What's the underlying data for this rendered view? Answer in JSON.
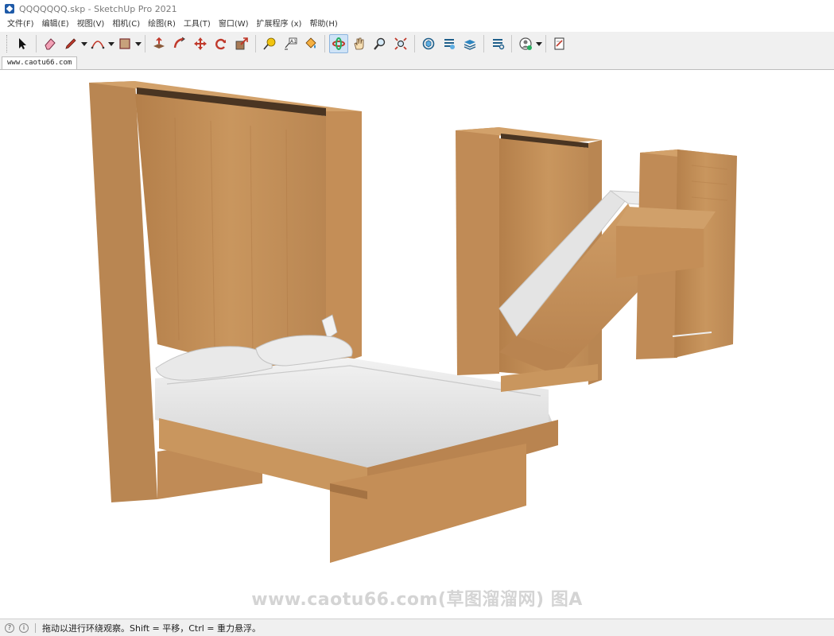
{
  "window": {
    "title": "QQQQQQQ.skp - SketchUp Pro 2021",
    "app_icon": "sketchup-logo-icon"
  },
  "menu": [
    {
      "label": "文件(F)"
    },
    {
      "label": "编辑(E)"
    },
    {
      "label": "视图(V)"
    },
    {
      "label": "相机(C)"
    },
    {
      "label": "绘图(R)"
    },
    {
      "label": "工具(T)"
    },
    {
      "label": "窗口(W)"
    },
    {
      "label": "扩展程序 (x)"
    },
    {
      "label": "帮助(H)"
    }
  ],
  "toolbar": {
    "tools": [
      "select-arrow-icon",
      "eraser-icon",
      "pencil-line-icon",
      "arc-icon",
      "rectangle-icon",
      "push-pull-icon",
      "follow-me-icon",
      "move-icon",
      "rotate-icon",
      "scale-icon",
      "tape-measure-icon",
      "text-label-icon",
      "paint-bucket-icon",
      "orbit-icon",
      "pan-hand-icon",
      "zoom-icon",
      "zoom-extents-icon",
      "3d-warehouse-icon",
      "extension-warehouse-icon",
      "layout-icon",
      "extension-manager-icon",
      "account-icon",
      "send-to-layout-icon"
    ],
    "active_tool": "orbit-icon"
  },
  "scene_tab": {
    "label": "www.caotu66.com"
  },
  "viewport": {
    "background": "#ffffff",
    "wood_color": "#c8955a",
    "sheet_color": "#e6e6e6",
    "watermark": "www.caotu66.com(草图溜溜网) 图A"
  },
  "status": {
    "icons": [
      "geo-location-icon",
      "info-icon"
    ],
    "text": "拖动以进行环绕观察。Shift = 平移，Ctrl = 重力悬浮。"
  }
}
